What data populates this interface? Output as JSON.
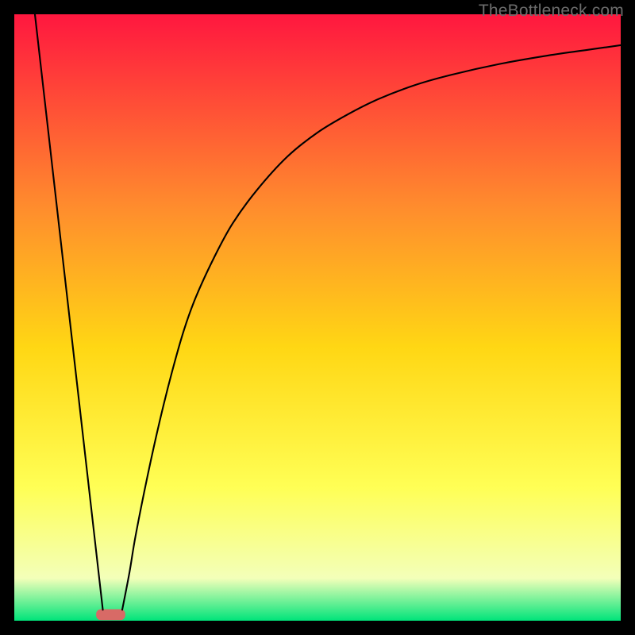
{
  "watermark": "TheBottleneck.com",
  "chart_data": {
    "type": "line",
    "title": "",
    "xlabel": "",
    "ylabel": "",
    "xlim": [
      0,
      100
    ],
    "ylim": [
      0,
      100
    ],
    "gradient_colors": {
      "top": "#ff173f",
      "upper_mid": "#ff8d2d",
      "mid": "#ffd714",
      "lower_mid": "#ffff55",
      "near_bottom": "#f3ffb9",
      "bottom": "#00e47a"
    },
    "marker": {
      "x": 15.9,
      "y": 1.0,
      "width": 4.8,
      "height": 1.8,
      "color": "#d86a66"
    },
    "series": [
      {
        "name": "left-line",
        "x": [
          3.4,
          14.6
        ],
        "y": [
          100,
          1.8
        ]
      },
      {
        "name": "right-curve",
        "x": [
          17.8,
          19,
          20,
          22,
          24,
          26,
          28,
          30,
          33,
          36,
          40,
          45,
          50,
          55,
          60,
          66,
          72,
          80,
          88,
          95,
          100
        ],
        "y": [
          1.8,
          8,
          14,
          24,
          33,
          41,
          48,
          53.5,
          60,
          65.5,
          71,
          76.5,
          80.5,
          83.5,
          86,
          88.3,
          90,
          91.8,
          93.2,
          94.2,
          94.9
        ]
      }
    ]
  }
}
